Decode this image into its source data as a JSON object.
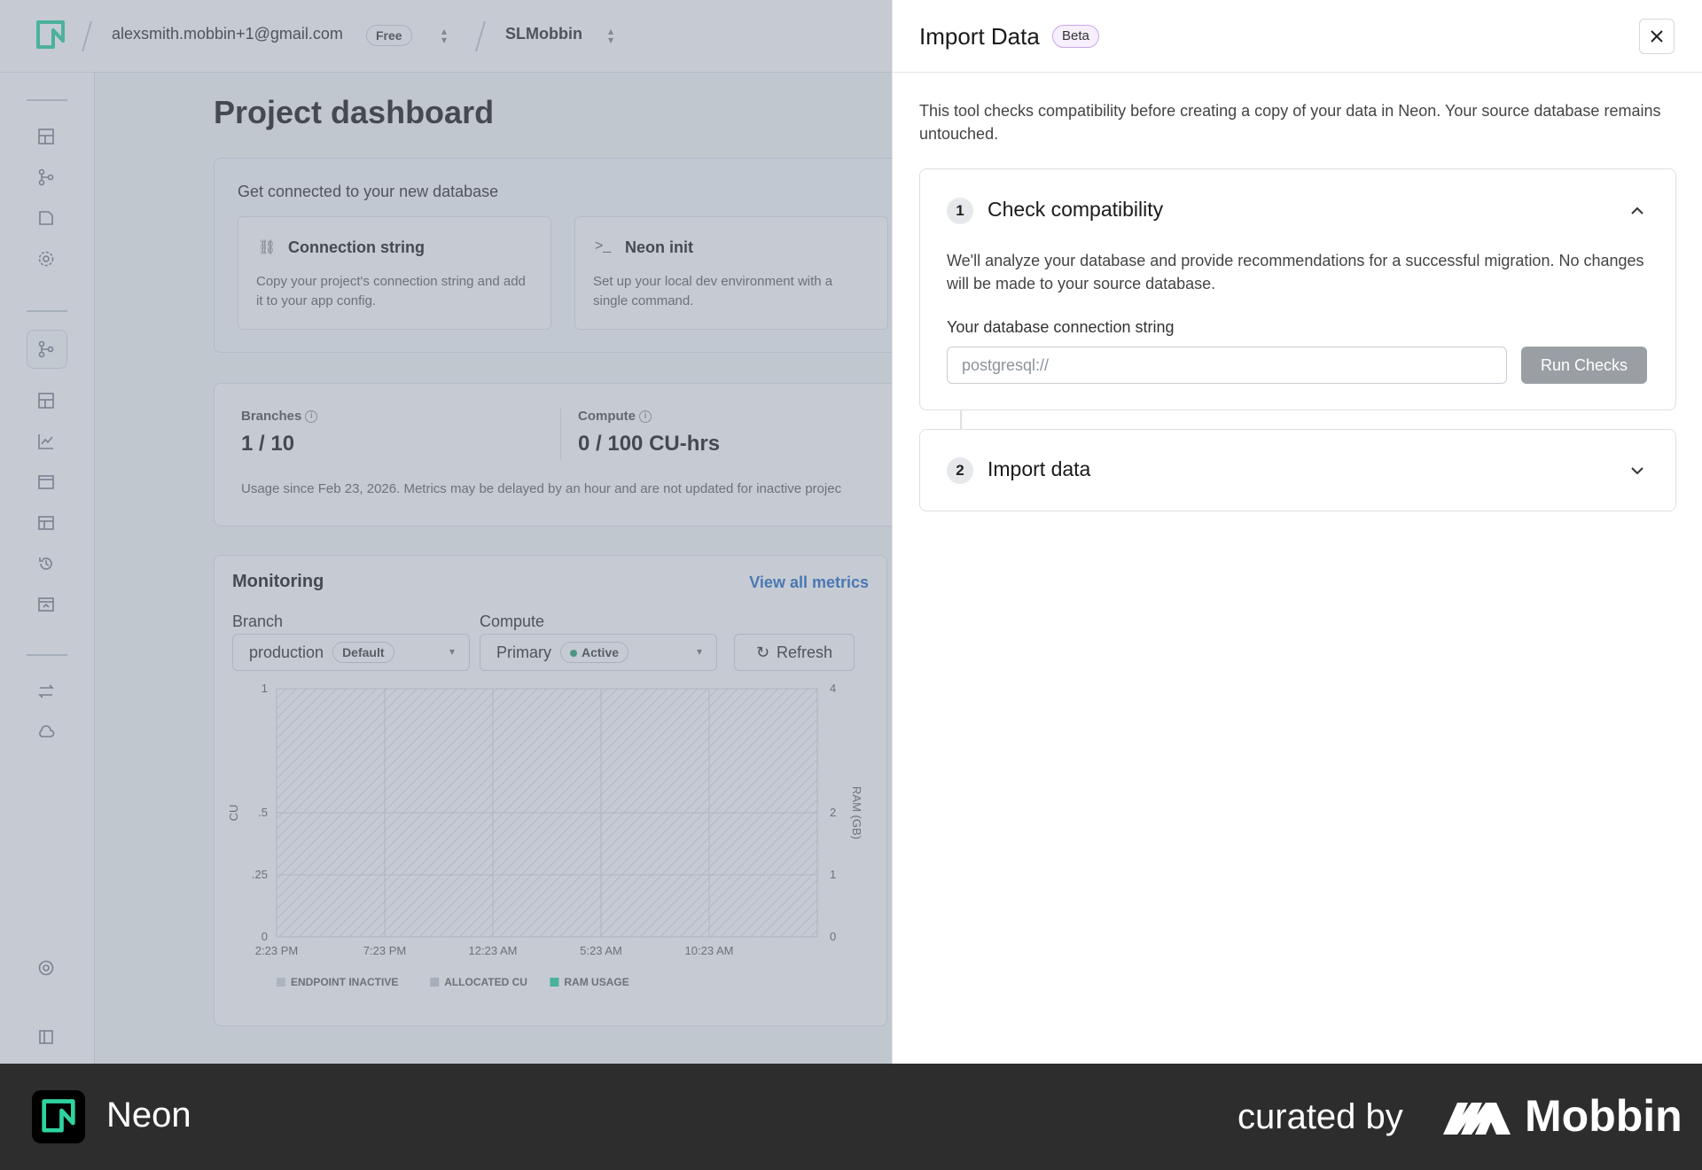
{
  "topbar": {
    "email": "alexsmith.mobbin+1@gmail.com",
    "plan": "Free",
    "project": "SLMobbin"
  },
  "dashboard": {
    "title": "Project dashboard",
    "connect_heading": "Get connected to your new database",
    "cards": [
      {
        "title": "Connection string",
        "desc": "Copy your project's connection string and add it to your app config."
      },
      {
        "title": "Neon init",
        "desc": "Set up your local dev environment with a single command."
      }
    ],
    "usage": {
      "branches_label": "Branches",
      "branches_value": "1 / 10",
      "compute_label": "Compute",
      "compute_value": "0 / 100",
      "compute_unit": "CU-hrs",
      "note": "Usage since Feb 23, 2026. Metrics may be delayed by an hour and are not updated for inactive projec"
    },
    "monitoring": {
      "title": "Monitoring",
      "view_all": "View all metrics",
      "branch_label": "Branch",
      "branch_value": "production",
      "branch_badge": "Default",
      "compute_label": "Compute",
      "compute_value": "Primary",
      "compute_badge": "Active",
      "refresh": "Refresh"
    }
  },
  "chart_data": {
    "type": "area",
    "categories": [
      "2:23 PM",
      "7:23 PM",
      "12:23 AM",
      "5:23 AM",
      "10:23 AM"
    ],
    "y_left_ticks": [
      "0",
      ".25",
      ".5",
      "1"
    ],
    "y_right_ticks": [
      "0",
      "1",
      "2",
      "4"
    ],
    "ylabel": "CU",
    "ylabel_right": "RAM (GB)",
    "ylim": [
      0,
      1
    ],
    "ylim_right": [
      0,
      4
    ],
    "series": [
      {
        "name": "ENDPOINT INACTIVE",
        "values": [
          0,
          0,
          0,
          0,
          0
        ]
      },
      {
        "name": "ALLOCATED CU",
        "values": [
          0,
          0,
          0,
          0,
          0
        ]
      },
      {
        "name": "RAM USAGE",
        "values": [
          0,
          0,
          0,
          0,
          0
        ]
      }
    ],
    "legend": "bottom"
  },
  "drawer": {
    "title": "Import Data",
    "badge": "Beta",
    "intro": "This tool checks compatibility before creating a copy of your data in Neon. Your source database remains untouched.",
    "step1": {
      "number": "1",
      "title": "Check compatibility",
      "desc": "We'll analyze your database and provide recommendations for a successful migration. No changes will be made to your source database.",
      "field_label": "Your database connection string",
      "placeholder": "postgresql://",
      "button": "Run Checks"
    },
    "step2": {
      "number": "2",
      "title": "Import data"
    }
  },
  "footer": {
    "brand": "Neon",
    "curated": "curated by",
    "mobbin": "Mobbin"
  },
  "colors": {
    "neon_green": "#2ed3a0",
    "link_blue": "#2a6fc7",
    "beta_border": "#c9a7ea",
    "active_green": "#2ea56f"
  }
}
